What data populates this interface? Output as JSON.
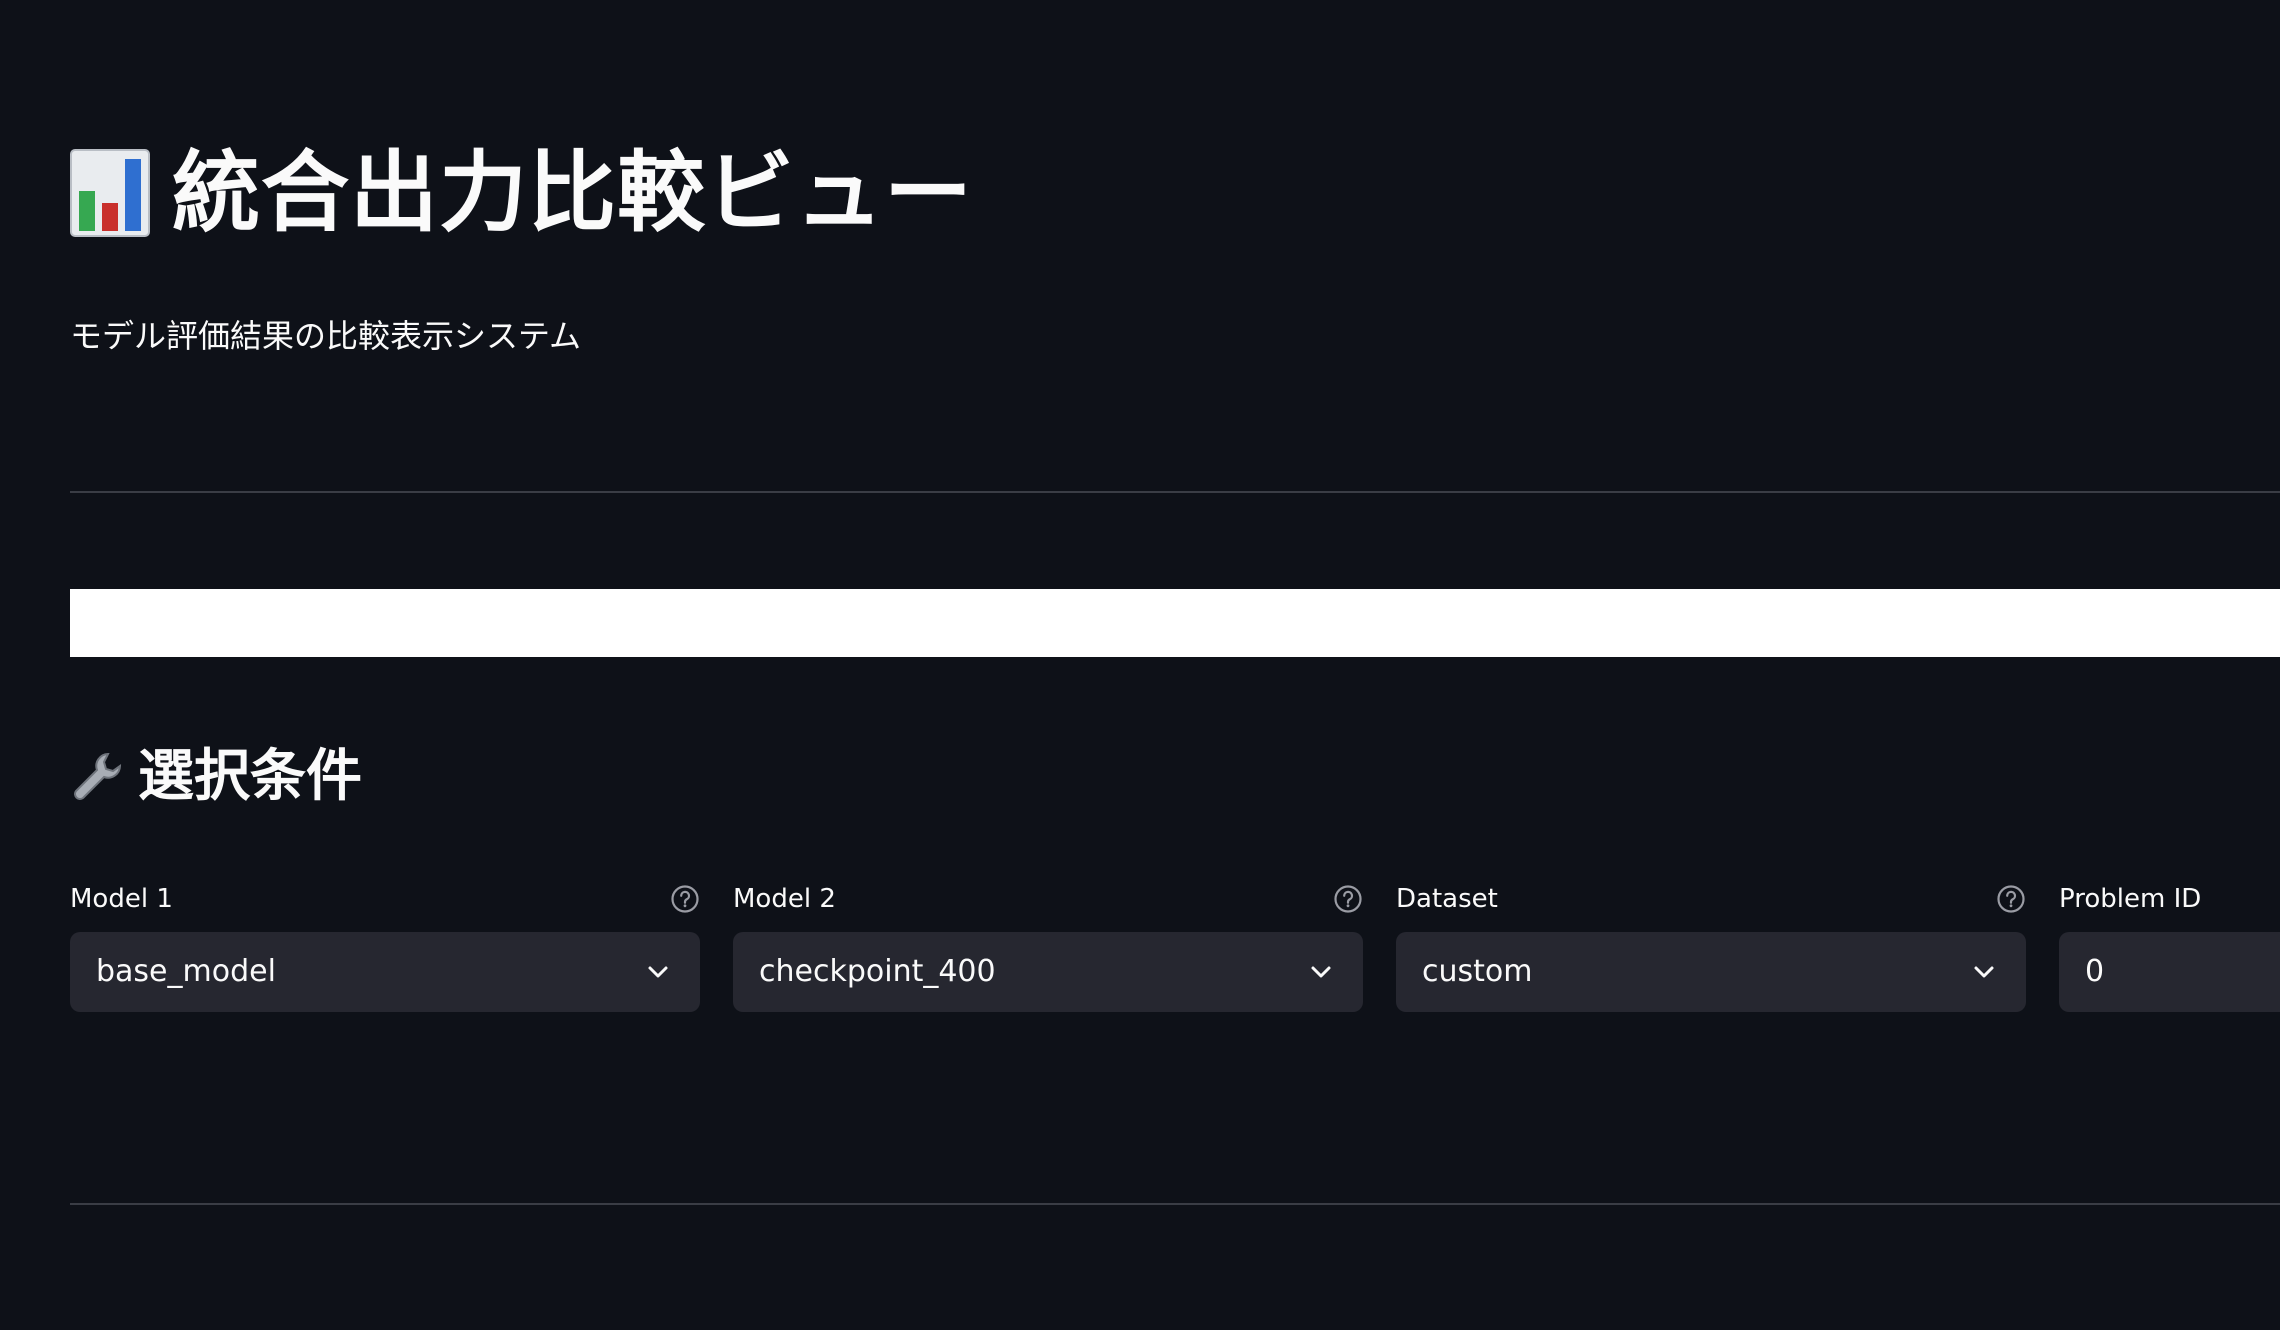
{
  "header": {
    "icon": "bar-chart-icon",
    "title": "統合出力比較ビュー",
    "subtitle": "モデル評価結果の比較表示システム"
  },
  "section": {
    "icon": "wrench-icon",
    "title": "選択条件"
  },
  "fields": [
    {
      "label": "Model 1",
      "value": "base_model",
      "help_icon": "help-circle-icon",
      "chevron_icon": "chevron-down-icon"
    },
    {
      "label": "Model 2",
      "value": "checkpoint_400",
      "help_icon": "help-circle-icon",
      "chevron_icon": "chevron-down-icon"
    },
    {
      "label": "Dataset",
      "value": "custom",
      "help_icon": "help-circle-icon",
      "chevron_icon": "chevron-down-icon"
    },
    {
      "label": "Problem ID",
      "value": "0"
    }
  ],
  "colors": {
    "background": "#0e1118",
    "text": "#fafafa",
    "select_background": "#262730",
    "divider": "#3a3d45",
    "icon_gray": "#9a9ca4",
    "bar_white": "#ffffff"
  }
}
